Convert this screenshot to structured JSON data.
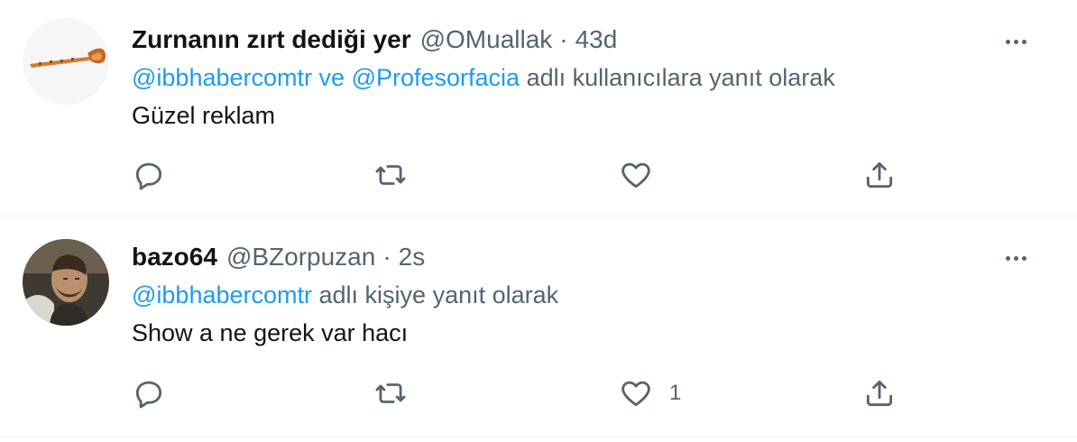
{
  "tweets": [
    {
      "display_name": "Zurnanın zırt dediği yer",
      "handle": "@OMuallak",
      "separator": "·",
      "timestamp": "43d",
      "reply_mentions": [
        "@ibbhabercomtr",
        "@Profesorfacia"
      ],
      "reply_joiner": "ve",
      "reply_suffix": "adlı kullanıcılara yanıt olarak",
      "text": "Güzel reklam",
      "like_count": ""
    },
    {
      "display_name": "bazo64",
      "handle": "@BZorpuzan",
      "separator": "·",
      "timestamp": "2s",
      "reply_mentions": [
        "@ibbhabercomtr"
      ],
      "reply_joiner": "",
      "reply_suffix": "adlı kişiye yanıt olarak",
      "text": "Show a ne gerek var hacı",
      "like_count": "1"
    }
  ],
  "icons": {
    "reply": "reply-icon",
    "retweet": "retweet-icon",
    "like": "heart-icon",
    "share": "share-icon",
    "more": "more-options-icon"
  },
  "colors": {
    "text": "#0f1419",
    "secondary_text": "#536471",
    "mention": "#1d9bf0",
    "divider": "#eff3f4"
  }
}
